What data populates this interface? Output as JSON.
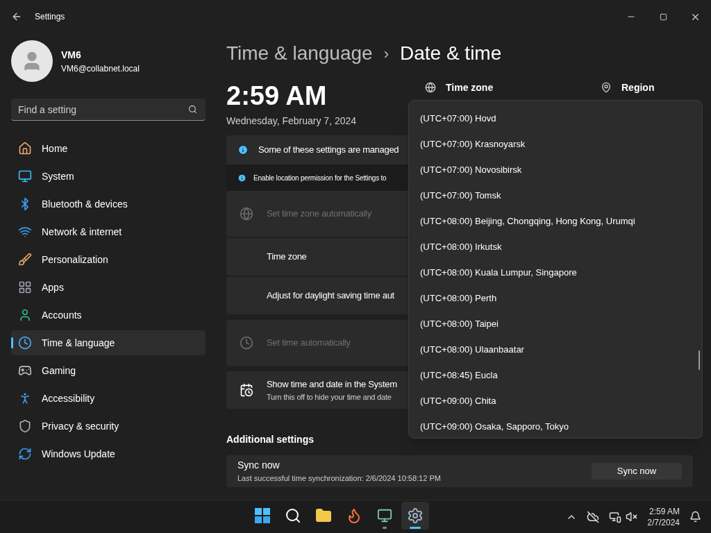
{
  "window": {
    "title": "Settings"
  },
  "user": {
    "name": "VM6",
    "email": "VM6@collabnet.local"
  },
  "search": {
    "placeholder": "Find a setting"
  },
  "sidebar": {
    "items": [
      {
        "label": "Home",
        "kind": "home",
        "selected": false
      },
      {
        "label": "System",
        "kind": "system",
        "selected": false
      },
      {
        "label": "Bluetooth & devices",
        "kind": "bluetooth",
        "selected": false
      },
      {
        "label": "Network & internet",
        "kind": "network",
        "selected": false
      },
      {
        "label": "Personalization",
        "kind": "personalization",
        "selected": false
      },
      {
        "label": "Apps",
        "kind": "apps",
        "selected": false
      },
      {
        "label": "Accounts",
        "kind": "accounts",
        "selected": false
      },
      {
        "label": "Time & language",
        "kind": "time",
        "selected": true
      },
      {
        "label": "Gaming",
        "kind": "gaming",
        "selected": false
      },
      {
        "label": "Accessibility",
        "kind": "accessibility",
        "selected": false
      },
      {
        "label": "Privacy & security",
        "kind": "privacy",
        "selected": false
      },
      {
        "label": "Windows Update",
        "kind": "update",
        "selected": false
      }
    ]
  },
  "breadcrumb": {
    "parent": "Time & language",
    "separator": "›",
    "current": "Date & time"
  },
  "clock": {
    "time": "2:59 AM",
    "date": "Wednesday, February 7, 2024"
  },
  "summary": [
    {
      "label": "Time zone",
      "kind": "globe"
    },
    {
      "label": "Region",
      "kind": "location"
    }
  ],
  "notices": [
    {
      "kind": "banner",
      "text": "Some of these settings are managed"
    },
    {
      "kind": "note",
      "text": "Enable location permission for the Settings to"
    }
  ],
  "setting_groups": [
    [
      {
        "kind": "timezone",
        "label": "Set time zone automatically",
        "disabled": true
      },
      {
        "kind": "plain",
        "label": "Time zone",
        "disabled": false
      },
      {
        "kind": "plain",
        "label": "Adjust for daylight saving time aut",
        "disabled": false
      }
    ],
    [
      {
        "kind": "time",
        "label": "Set time automatically",
        "disabled": true
      }
    ],
    [
      {
        "kind": "display",
        "label": "Show time and date in the System",
        "description": "Turn this off to hide your time and date",
        "disabled": false
      }
    ]
  ],
  "additional": {
    "heading": "Additional settings",
    "sync": {
      "label": "Sync now",
      "description": "Last successful time synchronization: 2/6/2024 10:58:12 PM",
      "button": "Sync now"
    }
  },
  "timezone_dropdown": {
    "options": [
      {
        "label": "(UTC+07:00) Hovd",
        "selected": false
      },
      {
        "label": "(UTC+07:00) Krasnoyarsk",
        "selected": false
      },
      {
        "label": "(UTC+07:00) Novosibirsk",
        "selected": false
      },
      {
        "label": "(UTC+07:00) Tomsk",
        "selected": false
      },
      {
        "label": "(UTC+08:00) Beijing, Chongqing, Hong Kong, Urumqi",
        "selected": false
      },
      {
        "label": "(UTC+08:00) Irkutsk",
        "selected": false
      },
      {
        "label": "(UTC+08:00) Kuala Lumpur, Singapore",
        "selected": false
      },
      {
        "label": "(UTC+08:00) Perth",
        "selected": false
      },
      {
        "label": "(UTC+08:00) Taipei",
        "selected": false
      },
      {
        "label": "(UTC+08:00) Ulaanbaatar",
        "selected": false
      },
      {
        "label": "(UTC+08:45) Eucla",
        "selected": false
      },
      {
        "label": "(UTC+09:00) Chita",
        "selected": false
      },
      {
        "label": "(UTC+09:00) Osaka, Sapporo, Tokyo",
        "selected": false
      }
    ]
  },
  "taskbar": {
    "apps": [
      {
        "kind": "start",
        "running": false,
        "active": false
      },
      {
        "kind": "search",
        "running": false,
        "active": false
      },
      {
        "kind": "explorer",
        "running": false,
        "active": false
      },
      {
        "kind": "firefox",
        "running": false,
        "active": false
      },
      {
        "kind": "remote",
        "running": true,
        "active": false
      },
      {
        "kind": "settings",
        "running": true,
        "active": true
      }
    ],
    "time": "2:59 AM",
    "date": "2/7/2024"
  }
}
